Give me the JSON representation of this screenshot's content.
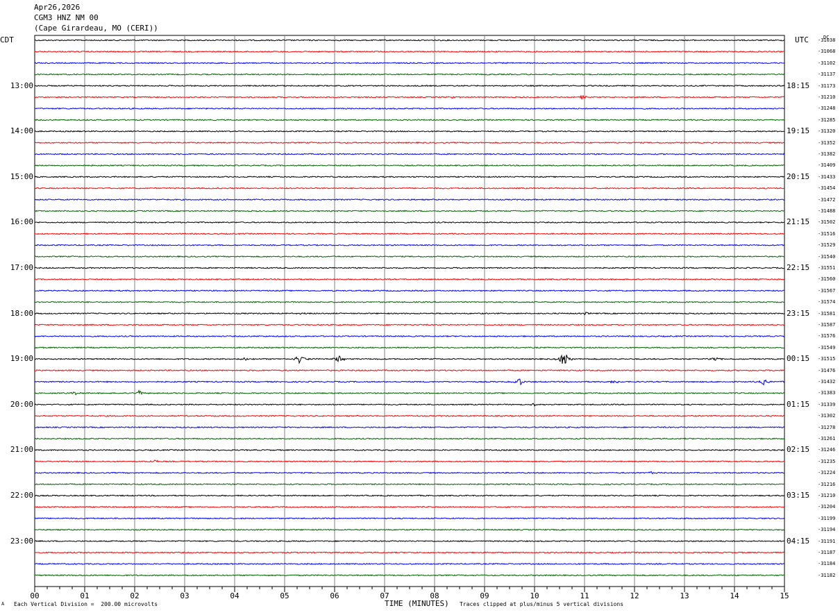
{
  "header": {
    "date": "Apr26,2026",
    "station": "CGM3 HNZ NM 00",
    "location": "(Cape Girardeau, MO (CERI))"
  },
  "left_tz": "CDT",
  "right_tz": "UTC",
  "dc_label": "DC",
  "footer": {
    "vertical_division": "Each Vertical Division =  200.00 microvolts",
    "clip_note": "Traces clipped at plus/minus 5 vertical divisions",
    "mark": "A"
  },
  "colors": {
    "cycle": [
      "#000000",
      "#ff0000",
      "#0000ff",
      "#006400"
    ],
    "grid": "#808080"
  },
  "chart_data": {
    "type": "line",
    "xlabel": "TIME (MINUTES)",
    "xlim": [
      0,
      15
    ],
    "x_ticks": [
      "00",
      "01",
      "02",
      "03",
      "04",
      "05",
      "06",
      "07",
      "08",
      "09",
      "10",
      "11",
      "12",
      "13",
      "14",
      "15"
    ],
    "left_hour_labels": [
      "13:00",
      "14:00",
      "15:00",
      "16:00",
      "17:00",
      "18:00",
      "19:00",
      "20:00",
      "21:00",
      "22:00",
      "23:00"
    ],
    "right_hour_labels": [
      "18:15",
      "19:15",
      "20:15",
      "21:15",
      "22:15",
      "23:15",
      "00:15",
      "01:15",
      "02:15",
      "03:15",
      "04:15"
    ],
    "trace_count": 48,
    "dc_offsets": [
      "-31038",
      "-31068",
      "-31102",
      "-31137",
      "-31173",
      "-31210",
      "-31248",
      "-31285",
      "-31320",
      "-31352",
      "-31382",
      "-31409",
      "-31433",
      "-31454",
      "-31472",
      "-31488",
      "-31502",
      "-31516",
      "-31529",
      "-31540",
      "-31551",
      "-31560",
      "-31567",
      "-31574",
      "-31581",
      "-31587",
      "-31576",
      "-31549",
      "-31515",
      "-31476",
      "-31432",
      "-31383",
      "-31339",
      "-31302",
      "-31278",
      "-31261",
      "-31246",
      "-31235",
      "-31224",
      "-31216",
      "-31210",
      "-31204",
      "-31199",
      "-31194",
      "-31191",
      "-31187",
      "-31184",
      "-31182"
    ],
    "events": [
      {
        "trace": 5,
        "minute": 8.4,
        "amp": 2.2
      },
      {
        "trace": 5,
        "minute": 10.95,
        "amp": 3.5
      },
      {
        "trace": 21,
        "minute": 8.2,
        "amp": 1.5
      },
      {
        "trace": 24,
        "minute": 5.3,
        "amp": 1.5
      },
      {
        "trace": 24,
        "minute": 11.0,
        "amp": 2.0
      },
      {
        "trace": 28,
        "minute": 4.2,
        "amp": 3.0
      },
      {
        "trace": 28,
        "minute": 5.3,
        "amp": 7.0
      },
      {
        "trace": 28,
        "minute": 6.1,
        "amp": 6.5
      },
      {
        "trace": 28,
        "minute": 10.6,
        "amp": 12.0
      },
      {
        "trace": 28,
        "minute": 13.6,
        "amp": 3.0
      },
      {
        "trace": 30,
        "minute": 9.7,
        "amp": 6.0
      },
      {
        "trace": 30,
        "minute": 11.6,
        "amp": 3.5
      },
      {
        "trace": 30,
        "minute": 14.6,
        "amp": 5.0
      },
      {
        "trace": 31,
        "minute": 0.8,
        "amp": 2.5
      },
      {
        "trace": 31,
        "minute": 2.1,
        "amp": 4.0
      },
      {
        "trace": 32,
        "minute": 10.0,
        "amp": 2.0
      },
      {
        "trace": 37,
        "minute": 2.4,
        "amp": 3.0
      },
      {
        "trace": 38,
        "minute": 12.3,
        "amp": 2.0
      }
    ]
  }
}
